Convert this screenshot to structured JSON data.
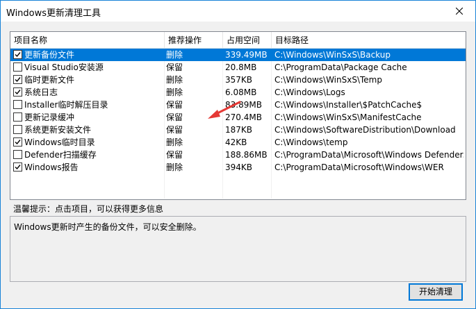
{
  "window": {
    "title": "Windows更新清理工具"
  },
  "columns": [
    "项目名称",
    "推荐操作",
    "占用空间",
    "目标路径"
  ],
  "rows": [
    {
      "name": "更新备份文件",
      "action": "删除",
      "size": "339.49MB",
      "path": "C:\\Windows\\WinSxS\\Backup",
      "checked": true,
      "selected": true
    },
    {
      "name": "Visual Studio安装源",
      "action": "保留",
      "size": "20.8MB",
      "path": "C:\\ProgramData\\Package Cache",
      "checked": false,
      "selected": false
    },
    {
      "name": "临时更新文件",
      "action": "删除",
      "size": "357KB",
      "path": "C:\\Windows\\WinSxS\\Temp",
      "checked": true,
      "selected": false
    },
    {
      "name": "系统日志",
      "action": "删除",
      "size": "6.08MB",
      "path": "C:\\Windows\\Logs",
      "checked": true,
      "selected": false
    },
    {
      "name": "Installer临时解压目录",
      "action": "保留",
      "size": "83.89MB",
      "path": "C:\\Windows\\Installer\\$PatchCache$",
      "checked": false,
      "selected": false
    },
    {
      "name": "更新记录缓冲",
      "action": "保留",
      "size": "270.4MB",
      "path": "C:\\Windows\\WinSxS\\ManifestCache",
      "checked": false,
      "selected": false
    },
    {
      "name": "系统更新安装文件",
      "action": "保留",
      "size": "187KB",
      "path": "C:\\Windows\\SoftwareDistribution\\Download",
      "checked": false,
      "selected": false
    },
    {
      "name": "Windows临时目录",
      "action": "删除",
      "size": "42KB",
      "path": "C:\\Windows\\temp",
      "checked": true,
      "selected": false
    },
    {
      "name": "Defender扫描缓存",
      "action": "保留",
      "size": "188.86MB",
      "path": "C:\\ProgramData\\Microsoft\\Windows Defender...",
      "checked": false,
      "selected": false
    },
    {
      "name": "Windows报告",
      "action": "删除",
      "size": "394KB",
      "path": "C:\\ProgramData\\Microsoft\\Windows\\WER",
      "checked": true,
      "selected": false
    }
  ],
  "hint": {
    "label": "温馨提示：点击项目，可以获得更多信息",
    "text": "Windows更新时产生的备份文件，可以安全删除。"
  },
  "buttons": {
    "start": "开始清理"
  },
  "colors": {
    "accent": "#0078d7",
    "arrow": "#e53935"
  }
}
